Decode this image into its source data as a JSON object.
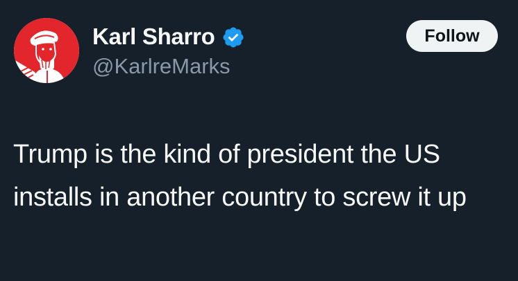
{
  "author": {
    "display_name": "Karl Sharro",
    "handle": "@KarlreMarks",
    "verified": true,
    "avatar_icon": "avatar-portrait-icon",
    "badge_icon": "verified-badge-icon",
    "badge_color": "#1d9bf0"
  },
  "actions": {
    "follow_label": "Follow"
  },
  "tweet": {
    "text": "Trump is the kind of president the US installs in another country to screw it up"
  },
  "colors": {
    "background": "#15202b",
    "text_primary": "#f7f9f9",
    "text_secondary": "#8b98a5",
    "avatar_red": "#e3262b",
    "button_bg": "#eff3f4"
  }
}
